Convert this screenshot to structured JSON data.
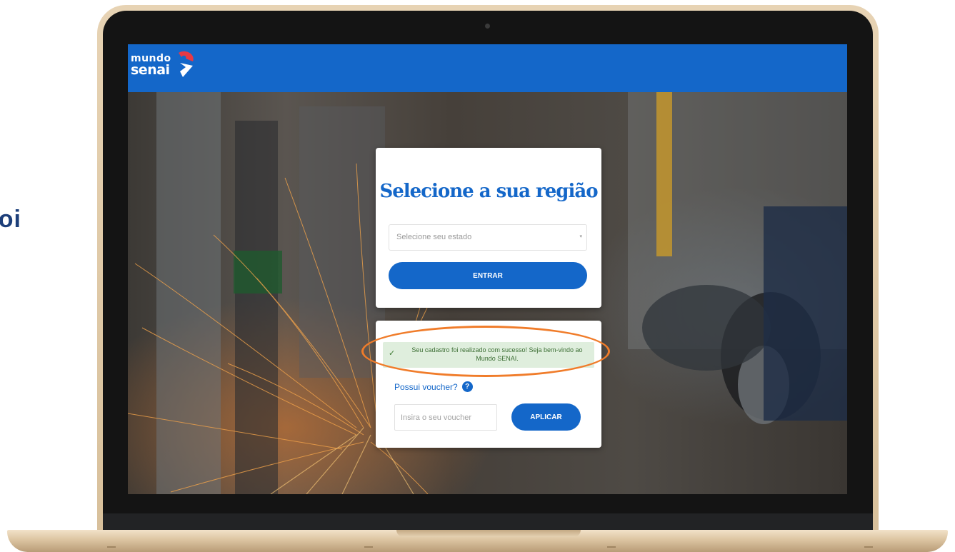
{
  "side_fragment": "oi",
  "brand": {
    "line1": "mundo",
    "line2": "senai",
    "primary_color": "#1467c9",
    "accent_color": "#e63946"
  },
  "region_card": {
    "title": "Selecione a sua região",
    "state_select": {
      "placeholder": "Selecione seu estado",
      "arrow": "▾"
    },
    "submit_label": "ENTRAR"
  },
  "voucher_card": {
    "alert": {
      "icon": "check-icon",
      "message": "Seu cadastro foi realizado com sucesso! Seja bem-vindo ao Mundo SENAI."
    },
    "question": "Possui voucher?",
    "help_glyph": "?",
    "input_placeholder": "Insira o seu voucher",
    "apply_label": "APLICAR"
  },
  "annotation": {
    "highlight_color": "#f07c2a"
  }
}
